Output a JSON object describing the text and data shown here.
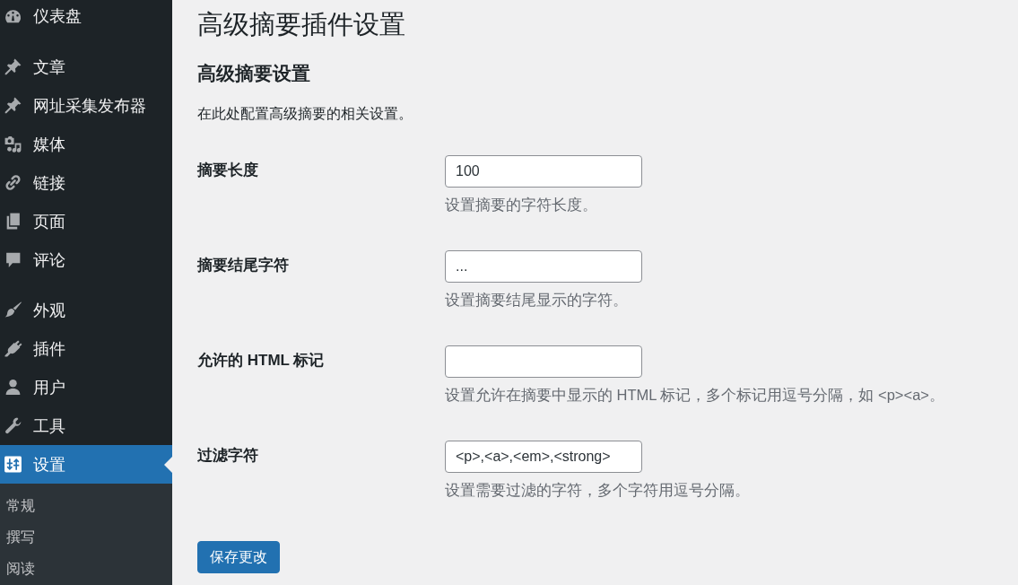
{
  "sidebar": {
    "groups": [
      {
        "items": [
          {
            "label": "仪表盘",
            "selected": false
          }
        ]
      },
      {
        "items": [
          {
            "label": "文章",
            "selected": false
          },
          {
            "label": "网址采集发布器",
            "selected": false
          },
          {
            "label": "媒体",
            "selected": false
          },
          {
            "label": "链接",
            "selected": false
          },
          {
            "label": "页面",
            "selected": false
          },
          {
            "label": "评论",
            "selected": false
          }
        ]
      },
      {
        "items": [
          {
            "label": "外观",
            "selected": false
          },
          {
            "label": "插件",
            "selected": false
          },
          {
            "label": "用户",
            "selected": false
          },
          {
            "label": "工具",
            "selected": false
          },
          {
            "label": "设置",
            "selected": true
          }
        ]
      }
    ],
    "submenu": [
      {
        "label": "常规",
        "selected": false
      },
      {
        "label": "撰写",
        "selected": false
      },
      {
        "label": "阅读",
        "selected": false
      }
    ]
  },
  "page_title": "高级摘要插件设置",
  "section": {
    "title": "高级摘要设置",
    "description": "在此处配置高级摘要的相关设置。"
  },
  "fields": [
    {
      "label": "摘要长度",
      "value": "100",
      "hint": "设置摘要的字符长度。"
    },
    {
      "label": "摘要结尾字符",
      "value": "...",
      "hint": "设置摘要结尾显示的字符。"
    },
    {
      "label": "允许的 HTML 标记",
      "hint": "设置允许在摘要中显示的 HTML 标记，多个标记用逗号分隔，如 <p><a>。"
    },
    {
      "label": "过滤字符",
      "value": "<p>,<a>,<em>,<strong>",
      "hint": "设置需要过滤的字符，多个字符用逗号分隔。"
    }
  ],
  "save_button": "保存更改"
}
